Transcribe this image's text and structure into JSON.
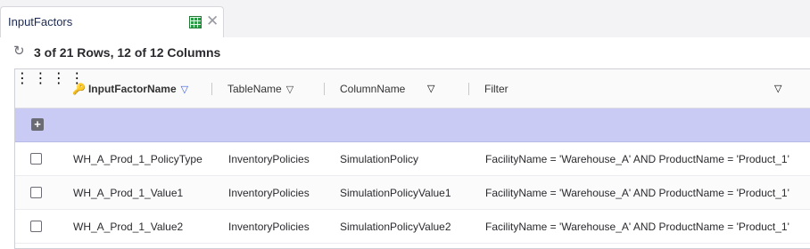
{
  "tab": {
    "title": "InputFactors",
    "icons": [
      "table-icon",
      "close-icon"
    ]
  },
  "toolbar": {
    "row_count": "3 of 21 Rows, 12 of 12 Columns",
    "refresh_icon": "refresh-icon"
  },
  "columns": [
    {
      "label": "InputFactorName",
      "is_key": true,
      "filter_active": true
    },
    {
      "label": "TableName",
      "is_key": false,
      "filter_active": false
    },
    {
      "label": "ColumnName",
      "is_key": false,
      "filter_active": false
    },
    {
      "label": "Filter",
      "is_key": false,
      "filter_active": false
    }
  ],
  "rows": [
    {
      "name": "WH_A_Prod_1_PolicyType",
      "table": "InventoryPolicies",
      "column": "SimulationPolicy",
      "filter": "FacilityName = 'Warehouse_A' AND ProductName = 'Product_1'"
    },
    {
      "name": "WH_A_Prod_1_Value1",
      "table": "InventoryPolicies",
      "column": "SimulationPolicyValue1",
      "filter": "FacilityName = 'Warehouse_A' AND ProductName = 'Product_1'"
    },
    {
      "name": "WH_A_Prod_1_Value2",
      "table": "InventoryPolicies",
      "column": "SimulationPolicyValue2",
      "filter": "FacilityName = 'Warehouse_A' AND ProductName = 'Product_1'"
    }
  ],
  "colors": {
    "accent_add_row": "#c9cbf4",
    "active_filter": "#3b5bdb",
    "tab_text": "#1b2a52"
  }
}
